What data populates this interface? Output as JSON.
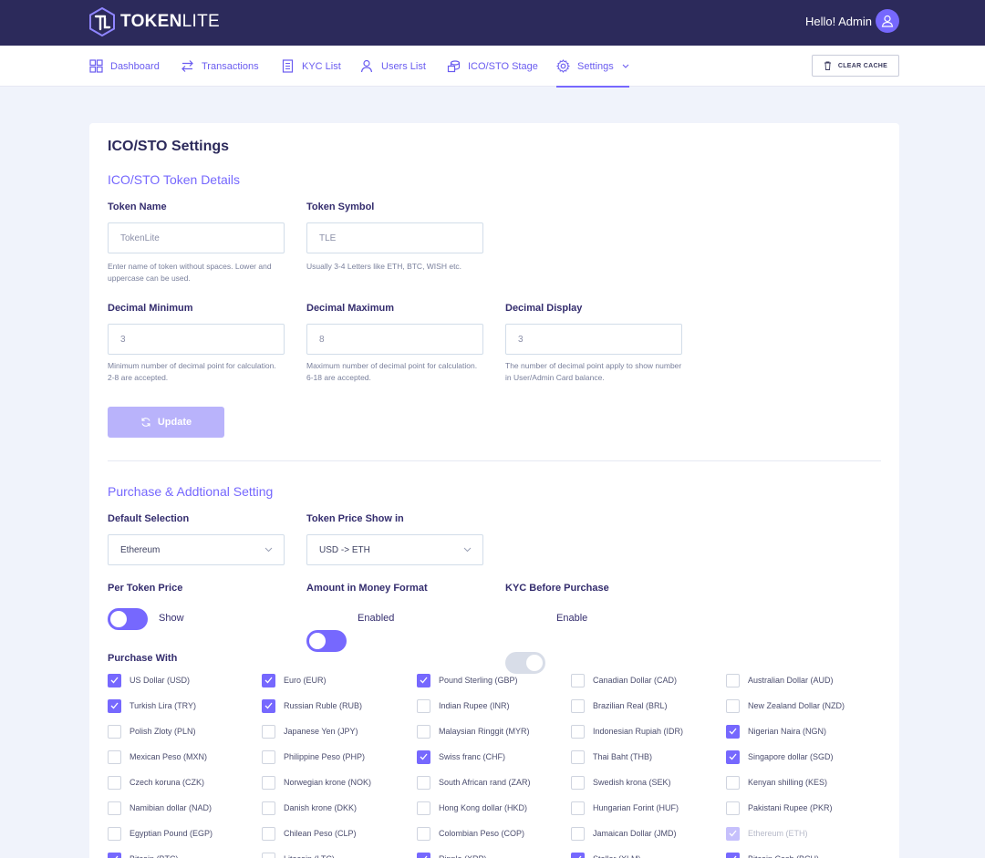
{
  "brand": {
    "name_bold": "TOKEN",
    "name_light": "LITE"
  },
  "header": {
    "greeting": "Hello! Admin"
  },
  "nav": [
    {
      "label": "Dashboard",
      "icon": "grid-icon"
    },
    {
      "label": "Transactions",
      "icon": "arrows-icon"
    },
    {
      "label": "KYC List",
      "icon": "document-icon"
    },
    {
      "label": "Users List",
      "icon": "users-icon"
    },
    {
      "label": "ICO/STO Stage",
      "icon": "coins-icon"
    },
    {
      "label": "Settings",
      "icon": "gear-icon",
      "active": true
    }
  ],
  "clear_cache": "CLEAR CACHE",
  "page_title": "ICO/STO Settings",
  "token_section": {
    "title": "ICO/STO Token Details",
    "token_name": {
      "label": "Token Name",
      "value": "TokenLite",
      "hint": "Enter name of token without spaces. Lower and uppercase can be used."
    },
    "token_symbol": {
      "label": "Token Symbol",
      "value": "TLE",
      "hint": "Usually 3-4 Letters like ETH, BTC, WISH etc."
    },
    "decimal_min": {
      "label": "Decimal Minimum",
      "value": "3",
      "hint": "Minimum number of decimal point for calculation. 2-8 are accepted."
    },
    "decimal_max": {
      "label": "Decimal Maximum",
      "value": "8",
      "hint": "Maximum number of decimal point for calculation. 6-18 are accepted."
    },
    "decimal_display": {
      "label": "Decimal Display",
      "value": "3",
      "hint": "The number of decimal point apply to show number in User/Admin Card balance."
    },
    "update_label": "Update"
  },
  "purchase_section": {
    "title": "Purchase & Addtional Setting",
    "default_selection": {
      "label": "Default Selection",
      "value": "Ethereum"
    },
    "token_price_show": {
      "label": "Token Price Show in",
      "value": "USD -> ETH"
    },
    "per_token_price": {
      "label": "Per Token Price",
      "toggle_text": "Show"
    },
    "money_format": {
      "label": "Amount in Money Format",
      "toggle_text": "Enabled"
    },
    "kyc_before": {
      "label": "KYC Before Purchase",
      "toggle_text": "Enable"
    },
    "purchase_with_label": "Purchase With",
    "currencies": [
      {
        "label": "US Dollar (USD)",
        "checked": true
      },
      {
        "label": "Euro (EUR)",
        "checked": true
      },
      {
        "label": "Pound Sterling (GBP)",
        "checked": true
      },
      {
        "label": "Canadian Dollar (CAD)",
        "checked": false
      },
      {
        "label": "Australian Dollar (AUD)",
        "checked": false
      },
      {
        "label": "Turkish Lira (TRY)",
        "checked": true
      },
      {
        "label": "Russian Ruble (RUB)",
        "checked": true
      },
      {
        "label": "Indian Rupee (INR)",
        "checked": false
      },
      {
        "label": "Brazilian Real (BRL)",
        "checked": false
      },
      {
        "label": "New Zealand Dollar (NZD)",
        "checked": false
      },
      {
        "label": "Polish Zloty (PLN)",
        "checked": false
      },
      {
        "label": "Japanese Yen (JPY)",
        "checked": false
      },
      {
        "label": "Malaysian Ringgit (MYR)",
        "checked": false
      },
      {
        "label": "Indonesian Rupiah (IDR)",
        "checked": false
      },
      {
        "label": "Nigerian Naira (NGN)",
        "checked": true
      },
      {
        "label": "Mexican Peso (MXN)",
        "checked": false
      },
      {
        "label": "Philippine Peso (PHP)",
        "checked": false
      },
      {
        "label": "Swiss franc (CHF)",
        "checked": true
      },
      {
        "label": "Thai Baht (THB)",
        "checked": false
      },
      {
        "label": "Singapore dollar (SGD)",
        "checked": true
      },
      {
        "label": "Czech koruna (CZK)",
        "checked": false
      },
      {
        "label": "Norwegian krone (NOK)",
        "checked": false
      },
      {
        "label": "South African rand (ZAR)",
        "checked": false
      },
      {
        "label": "Swedish krona (SEK)",
        "checked": false
      },
      {
        "label": "Kenyan shilling (KES)",
        "checked": false
      },
      {
        "label": "Namibian dollar (NAD)",
        "checked": false
      },
      {
        "label": "Danish krone (DKK)",
        "checked": false
      },
      {
        "label": "Hong Kong dollar (HKD)",
        "checked": false
      },
      {
        "label": "Hungarian Forint (HUF)",
        "checked": false
      },
      {
        "label": "Pakistani Rupee (PKR)",
        "checked": false
      },
      {
        "label": "Egyptian Pound (EGP)",
        "checked": false
      },
      {
        "label": "Chilean Peso (CLP)",
        "checked": false
      },
      {
        "label": "Colombian Peso (COP)",
        "checked": false
      },
      {
        "label": "Jamaican Dollar (JMD)",
        "checked": false
      },
      {
        "label": "Ethereum (ETH)",
        "checked": true,
        "disabled": true
      },
      {
        "label": "Bitcoin (BTC)",
        "checked": true
      },
      {
        "label": "Litecoin (LTC)",
        "checked": false
      },
      {
        "label": "Ripple (XRP)",
        "checked": true
      },
      {
        "label": "Stellar (XLM)",
        "checked": true
      },
      {
        "label": "Bitcoin Cash (BCH)",
        "checked": true
      }
    ]
  }
}
